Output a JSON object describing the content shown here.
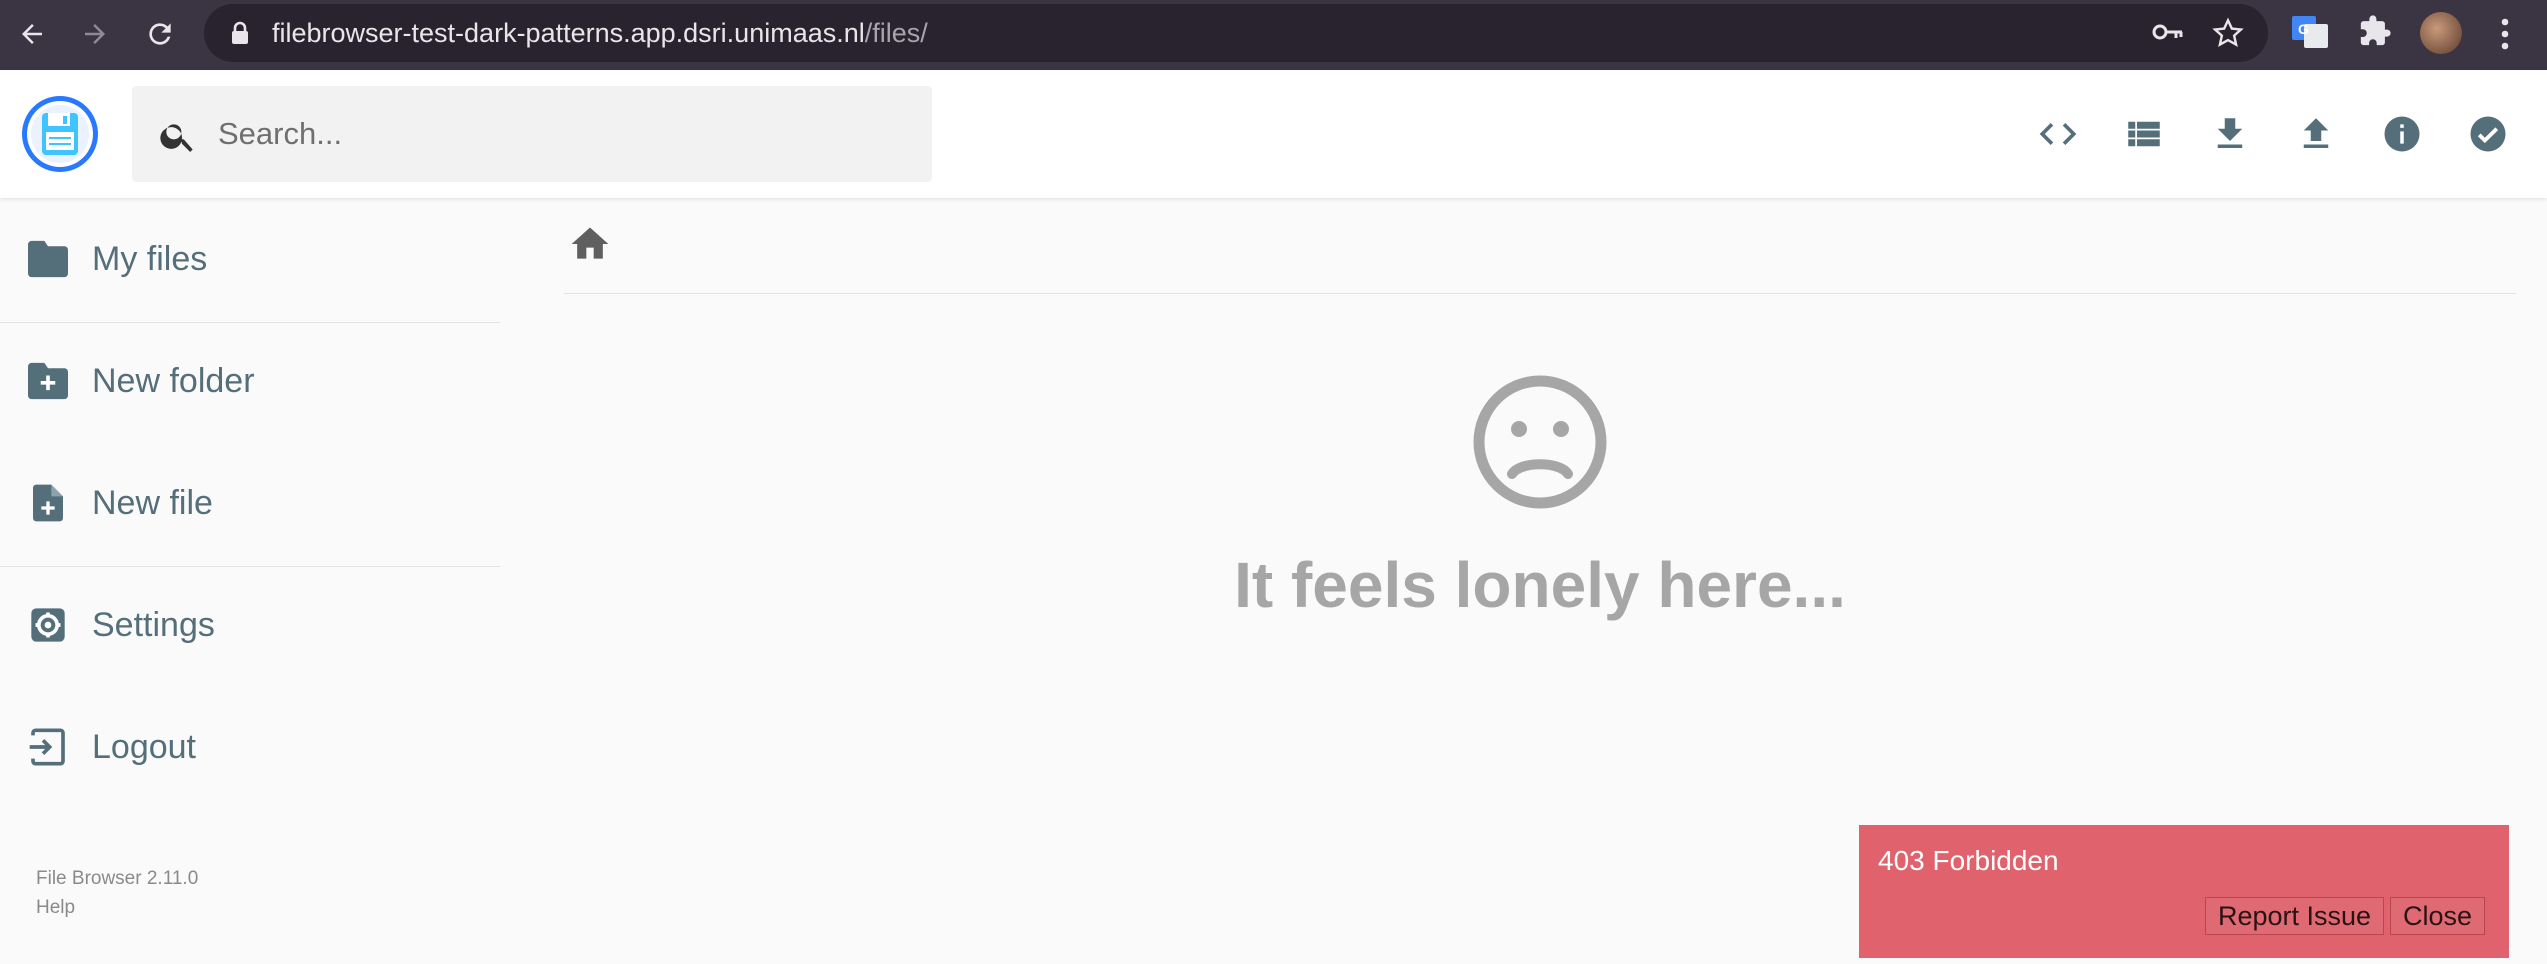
{
  "browser": {
    "url_host": "filebrowser-test-dark-patterns.app.dsri.unimaas.nl",
    "url_path": "/files/",
    "colors": {
      "chrome_bg": "#3b3443",
      "omnibox_bg": "#29232f"
    }
  },
  "header": {
    "search_placeholder": "Search...",
    "actions": [
      "code-view-icon",
      "list-view-icon",
      "download-icon",
      "upload-icon",
      "info-icon",
      "select-icon"
    ]
  },
  "sidebar": {
    "items": [
      {
        "label": "My files",
        "icon": "folder-icon"
      },
      {
        "label": "New folder",
        "icon": "create-new-folder-icon"
      },
      {
        "label": "New file",
        "icon": "note-add-icon"
      },
      {
        "label": "Settings",
        "icon": "settings-icon"
      },
      {
        "label": "Logout",
        "icon": "exit-icon"
      }
    ],
    "version": "File Browser 2.11.0",
    "help": "Help"
  },
  "main": {
    "breadcrumb_icon": "home-icon",
    "empty_icon": "sad-face-icon",
    "empty_message": "It feels lonely here..."
  },
  "toast": {
    "message": "403 Forbidden",
    "report_label": "Report Issue",
    "close_label": "Close",
    "color": "#e0626c"
  },
  "theme": {
    "accent": "#2979ff",
    "sidebar_text": "#546e7a",
    "header_icon": "#546e7a"
  }
}
